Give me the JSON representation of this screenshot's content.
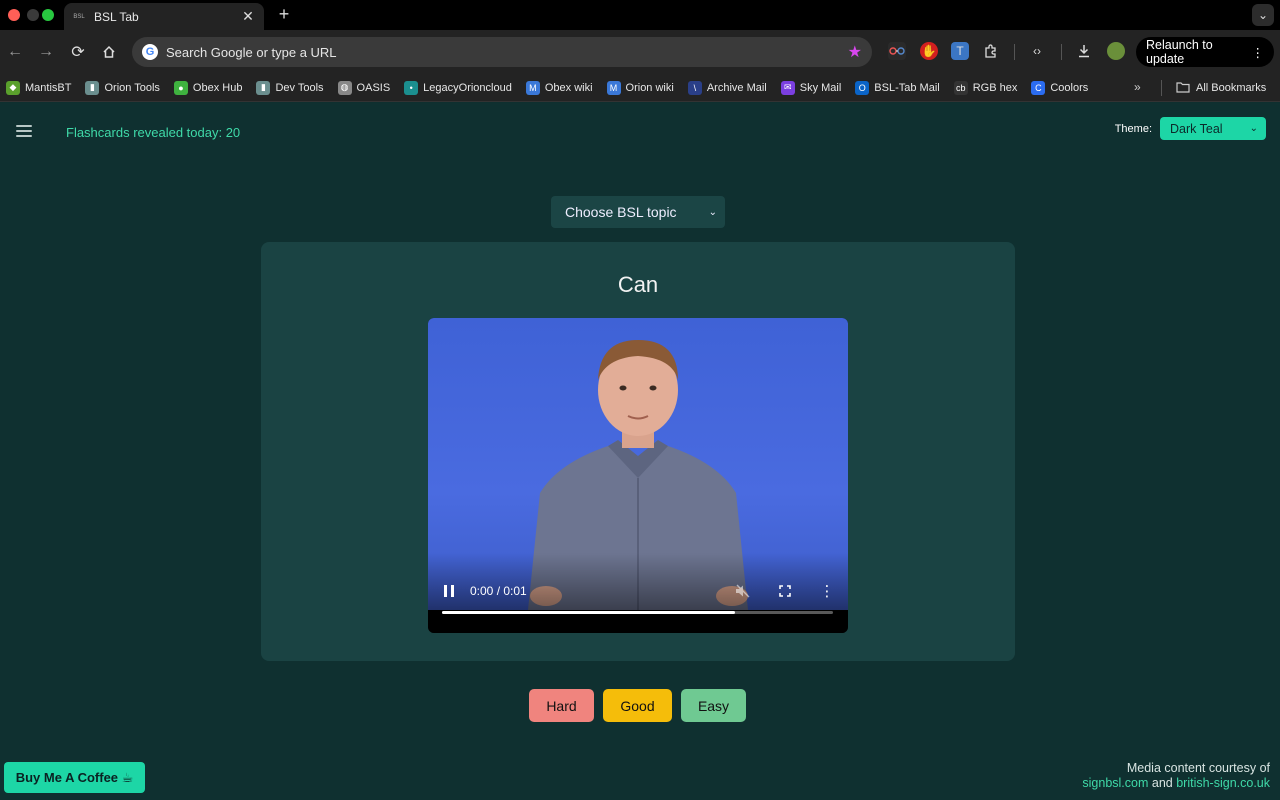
{
  "browser": {
    "tab": {
      "favicon": "BSL",
      "title": "BSL Tab"
    },
    "omnibox_placeholder": "Search Google or type a URL",
    "relaunch_label": "Relaunch to update",
    "bookmarks": [
      {
        "label": "MantisBT",
        "icon": "mantis-icon",
        "color": "#5aa02c"
      },
      {
        "label": "Orion Tools",
        "icon": "folder-doc-icon",
        "color": "#6b8f8f"
      },
      {
        "label": "Obex Hub",
        "icon": "green-circle-icon",
        "color": "#3fb23f"
      },
      {
        "label": "Dev Tools",
        "icon": "folder-doc-icon",
        "color": "#6b8f8f"
      },
      {
        "label": "OASIS",
        "icon": "globe-icon",
        "color": "#888888"
      },
      {
        "label": "LegacyOrioncloud",
        "icon": "dot-icon",
        "color": "#1b8f8f"
      },
      {
        "label": "Obex wiki",
        "icon": "wiki-icon",
        "color": "#3a78d8"
      },
      {
        "label": "Orion wiki",
        "icon": "wiki-icon",
        "color": "#3a78d8"
      },
      {
        "label": "Archive Mail",
        "icon": "mail-slash-icon",
        "color": "#2a3f88"
      },
      {
        "label": "Sky Mail",
        "icon": "mail-icon",
        "color": "#7b3fe0"
      },
      {
        "label": "BSL-Tab Mail",
        "icon": "outlook-icon",
        "color": "#0a64c8"
      },
      {
        "label": "RGB hex",
        "icon": "cb-icon",
        "color": "#333333"
      },
      {
        "label": "Coolors",
        "icon": "coolors-icon",
        "color": "#2b6cf0"
      }
    ],
    "bookmarks_more": "»",
    "all_bookmarks": "All Bookmarks"
  },
  "page": {
    "counter": "Flashcards revealed today: 20",
    "theme_label": "Theme:",
    "theme_value": "Dark Teal",
    "topic_value": "Choose BSL topic",
    "word": "Can",
    "video": {
      "time": "0:00 / 0:01",
      "progress": 0.75
    },
    "buttons": {
      "hard": "Hard",
      "good": "Good",
      "easy": "Easy"
    },
    "coffee_label": "Buy Me A Coffee ☕",
    "credits": {
      "line1": "Media content courtesy of",
      "link1": "signbsl.com",
      "and": " and ",
      "link2": "british-sign.co.uk"
    }
  },
  "colors": {
    "page_bg": "#0f3030",
    "card_bg": "#1a4343",
    "accent": "#1dd6a6",
    "hard": "#f0847e",
    "good": "#f5bd0a",
    "easy": "#6fc992"
  }
}
